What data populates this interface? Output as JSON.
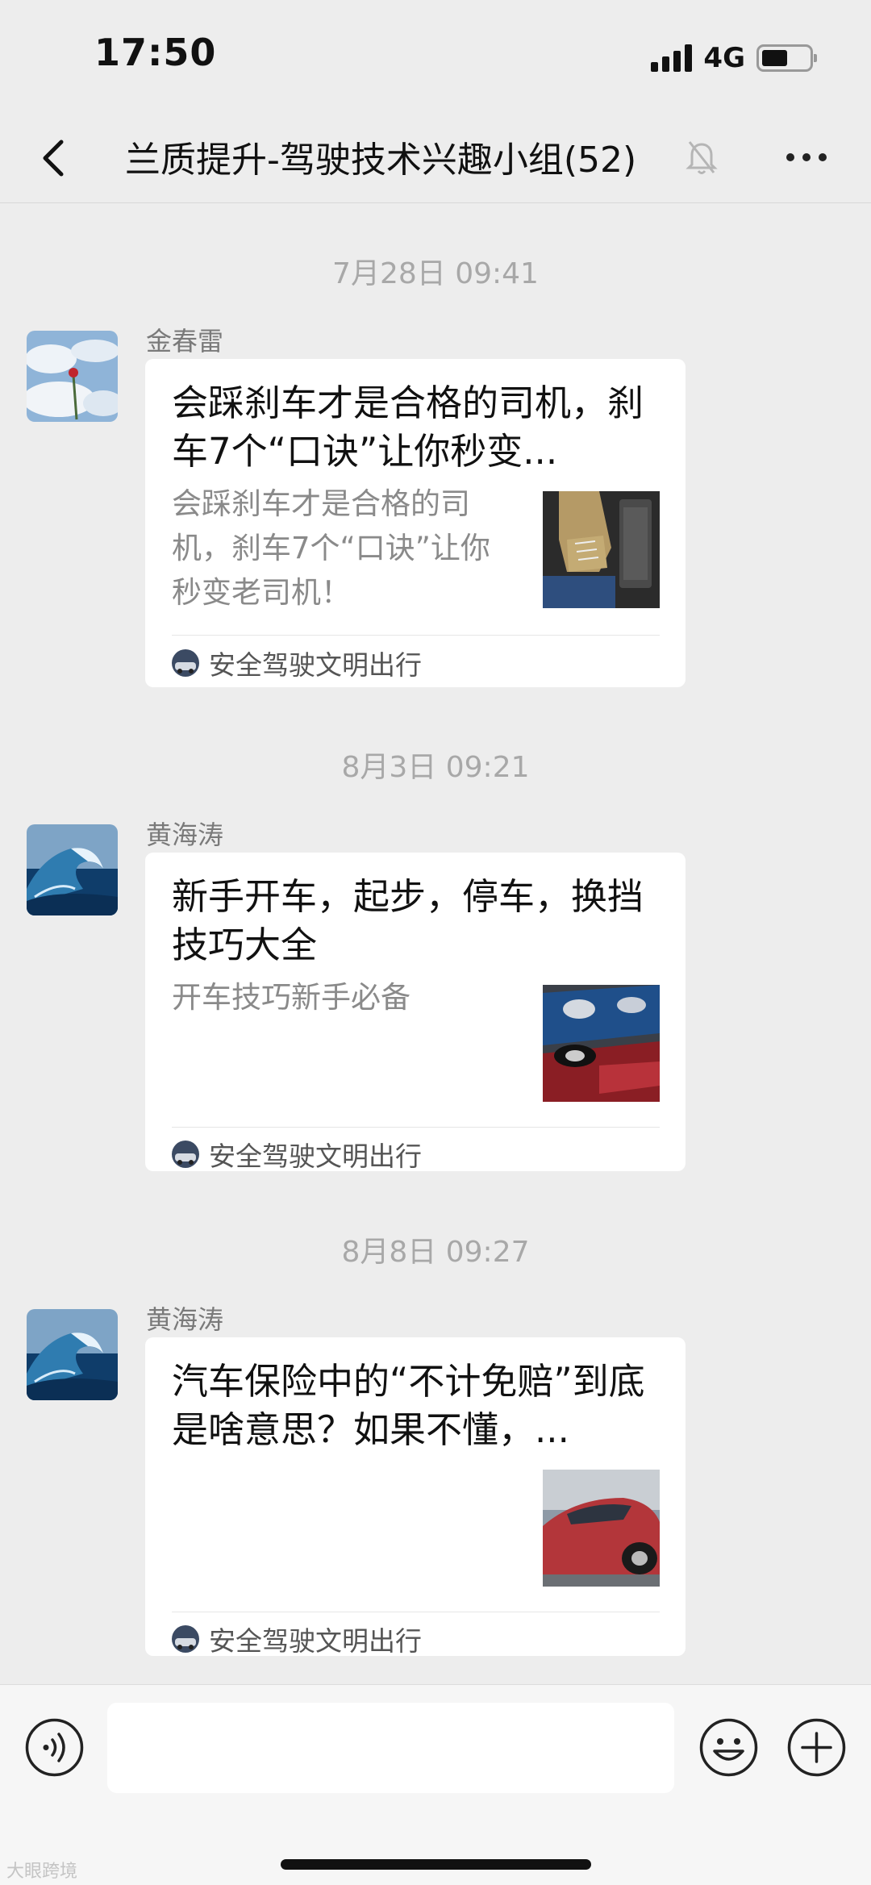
{
  "status_bar": {
    "time": "17:50",
    "network": "4G",
    "battery_level": 0.55,
    "signal_bars": 4
  },
  "header": {
    "title": "兰质提升-驾驶技术兴趣小组(52)",
    "icons": [
      "back-icon",
      "mute-bell-icon",
      "more-icon"
    ]
  },
  "messages": [
    {
      "timestamp": "7月28日 09:41",
      "sender": "金春雷",
      "card": {
        "title": "会踩刹车才是合格的司机，刹车7个“口诀”让你秒变...",
        "description": "会踩刹车才是合格的司机，刹车7个“口诀”让你秒变老司机！",
        "source": "安全驾驶文明出行"
      }
    },
    {
      "timestamp": "8月3日 09:21",
      "sender": "黄海涛",
      "card": {
        "title": "新手开车，起步，停车，换挡技巧大全",
        "description": "开车技巧新手必备",
        "source": "安全驾驶文明出行"
      }
    },
    {
      "timestamp": "8月8日 09:27",
      "sender": "黄海涛",
      "card": {
        "title": "汽车保险中的“不计免赔”到底是啥意思？如果不懂，...",
        "description": "",
        "source": "安全驾驶文明出行"
      }
    }
  ],
  "input_bar": {
    "placeholder": "",
    "icons": [
      "voice-icon",
      "emoji-icon",
      "plus-icon"
    ]
  },
  "watermark": "大眼跨境",
  "colors": {
    "background": "#ededed",
    "card": "#ffffff",
    "timestamp": "#a8a8a8"
  }
}
